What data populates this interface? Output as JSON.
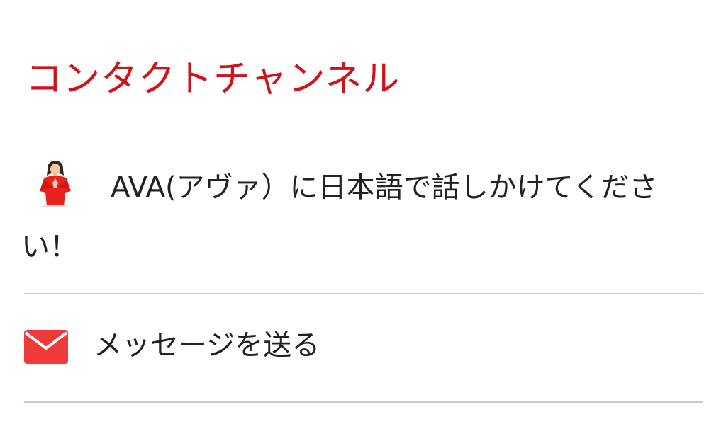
{
  "section": {
    "title": "コンタクトチャンネル"
  },
  "channels": {
    "ava": {
      "text": "AVA(アヴァ）に日本語で話しかけてください！",
      "icon": "ava-avatar-icon"
    },
    "message": {
      "label": "メッセージを送る",
      "icon": "mail-icon"
    }
  },
  "colors": {
    "title": "#d0121b",
    "icon_red": "#f03a3a",
    "text": "#222222",
    "divider": "#c9c9dc"
  }
}
